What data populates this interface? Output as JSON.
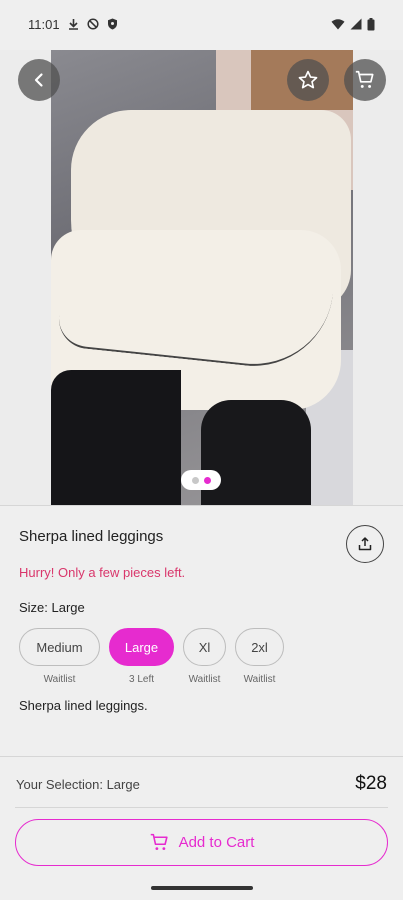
{
  "status_bar": {
    "time": "11:01"
  },
  "product": {
    "title": "Sherpa lined leggings",
    "alert": "Hurry! Only a few pieces left.",
    "size_label": "Size: Large",
    "description": "Sherpa lined leggings.",
    "image_pages": 2,
    "current_image": 1
  },
  "sizes": [
    {
      "label": "Medium",
      "stock": "Waitlist",
      "selected": false
    },
    {
      "label": "Large",
      "stock": "3 Left",
      "selected": true
    },
    {
      "label": "Xl",
      "stock": "Waitlist",
      "selected": false
    },
    {
      "label": "2xl",
      "stock": "Waitlist",
      "selected": false
    }
  ],
  "footer": {
    "selection": "Your Selection: Large",
    "price": "$28",
    "add_to_cart": "Add to Cart"
  },
  "colors": {
    "accent": "#e62bcf",
    "alert": "#d9366b"
  },
  "icons": [
    "back-icon",
    "star-icon",
    "cart-icon",
    "share-icon",
    "download-icon",
    "block-icon",
    "shield-icon",
    "wifi-icon",
    "signal-icon",
    "battery-icon"
  ]
}
